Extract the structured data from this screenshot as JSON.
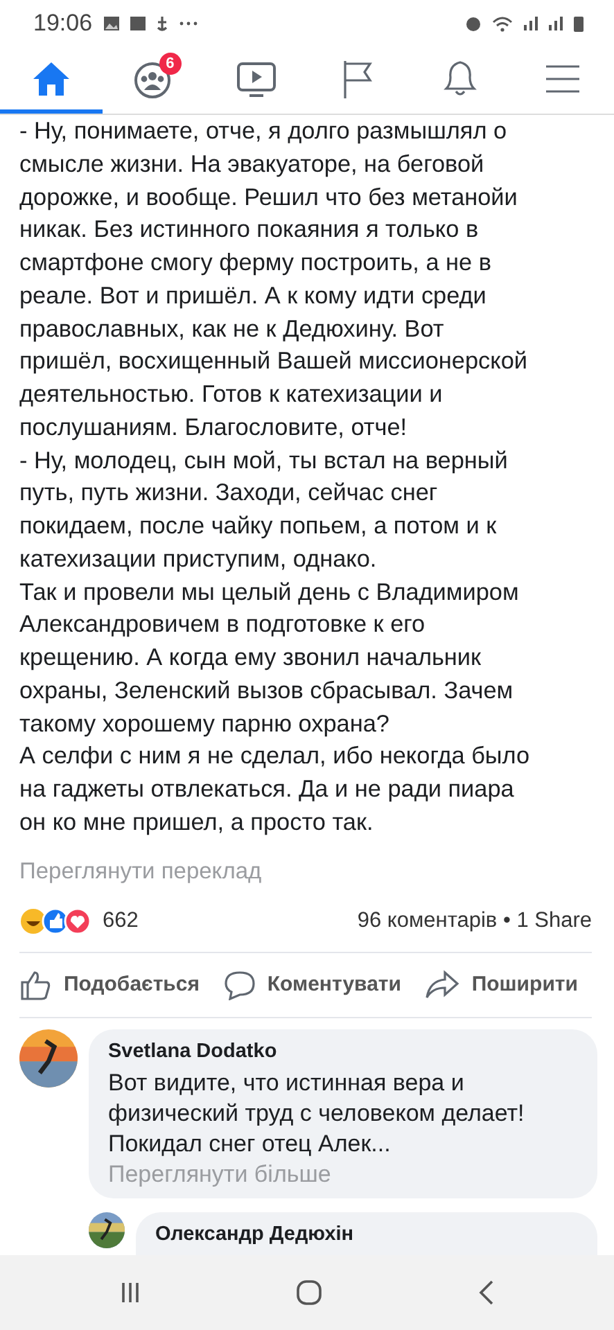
{
  "status_bar": {
    "time": "19:06"
  },
  "nav_tabs": [
    {
      "kind": "home",
      "selected": true
    },
    {
      "kind": "groups",
      "selected": false,
      "badge": "6"
    },
    {
      "kind": "video",
      "selected": false
    },
    {
      "kind": "pages",
      "selected": false
    },
    {
      "kind": "notifications",
      "selected": false
    },
    {
      "kind": "menu",
      "selected": false
    }
  ],
  "post": {
    "lines": [
      "- Ну, понимаете, отче, я долго размышлял о",
      "смысле жизни. На эвакуаторе, на беговой",
      "дорожке, и вообще. Решил что без метанойи",
      "никак. Без истинного покаяния я только в",
      "смартфоне смогу ферму построить, а не в",
      "реале. Вот и пришёл. А к кому идти среди",
      "православных, как не к Дедюхину. Вот",
      "пришёл, восхищенный Вашей миссионерской",
      "деятельностью. Готов к катехизации и",
      "послушаниям. Благословите, отче!",
      "- Ну, молодец, сын мой, ты встал на верный",
      "путь, путь жизни. Заходи, сейчас снег",
      "покидаем, после чайку попьем, а потом и к",
      "катехизации приступим, однако.",
      "Так и провели мы целый день с Владимиром",
      "Александровичем в подготовке к его",
      "крещению. А когда ему звонил начальник",
      "охраны, Зеленский вызов сбрасывал. Зачем",
      "такому хорошему парню охрана?",
      "А селфи с ним я не сделал, ибо некогда было",
      "на гаджеты отвлекаться. Да и не ради пиара",
      "он ко мне пришел, а просто так."
    ],
    "translate_link": "Переглянути переклад",
    "reaction_count": "662",
    "comments_shares": "96 коментарів • 1 Share",
    "actions": [
      {
        "kind": "like",
        "label": "Подобається"
      },
      {
        "kind": "comment",
        "label": "Коментувати"
      },
      {
        "kind": "share",
        "label": "Поширити"
      }
    ]
  },
  "comments": [
    {
      "author": "Svetlana  Dodatko",
      "lines": [
        "Вот видите, что истинная вера и",
        "физический труд с человеком делает!",
        "Покидал снег отец Алек..."
      ],
      "more": "Переглянути більше",
      "reply": false
    },
    {
      "author": "Олександр Дедюхін",
      "reply": true
    }
  ]
}
